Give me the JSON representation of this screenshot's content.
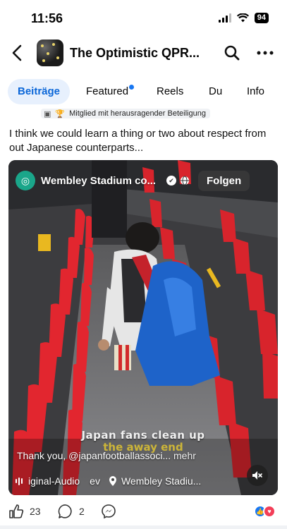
{
  "status_bar": {
    "time": "11:56",
    "battery": "94"
  },
  "header": {
    "title": "The Optimistic QPR..."
  },
  "tabs": [
    {
      "label": "Beiträge",
      "active": true
    },
    {
      "label": "Featured",
      "has_dot": true
    },
    {
      "label": "Reels"
    },
    {
      "label": "Du"
    },
    {
      "label": "Info"
    }
  ],
  "post": {
    "meta_badge": "Mitglied mit herausragender Beteiligung",
    "text": "I think we could learn a thing or two about respect from out Japanese counterparts..."
  },
  "video": {
    "page_name": "Wembley Stadium co...",
    "follow_label": "Folgen",
    "overlay_title": "Japan fans clean up",
    "overlay_subtitle": "the away end",
    "caption": "Thank you, @japanfootballassoci...",
    "caption_more": "mehr",
    "audio_label": "iginal-Audio",
    "audio_suffix": "ev",
    "location": "Wembley Stadiu..."
  },
  "actions": {
    "likes": "23",
    "comments": "2"
  },
  "colors": {
    "accent": "#1877f2",
    "active_tab_bg": "#e7f0fd",
    "seat_red": "#e2262f"
  }
}
